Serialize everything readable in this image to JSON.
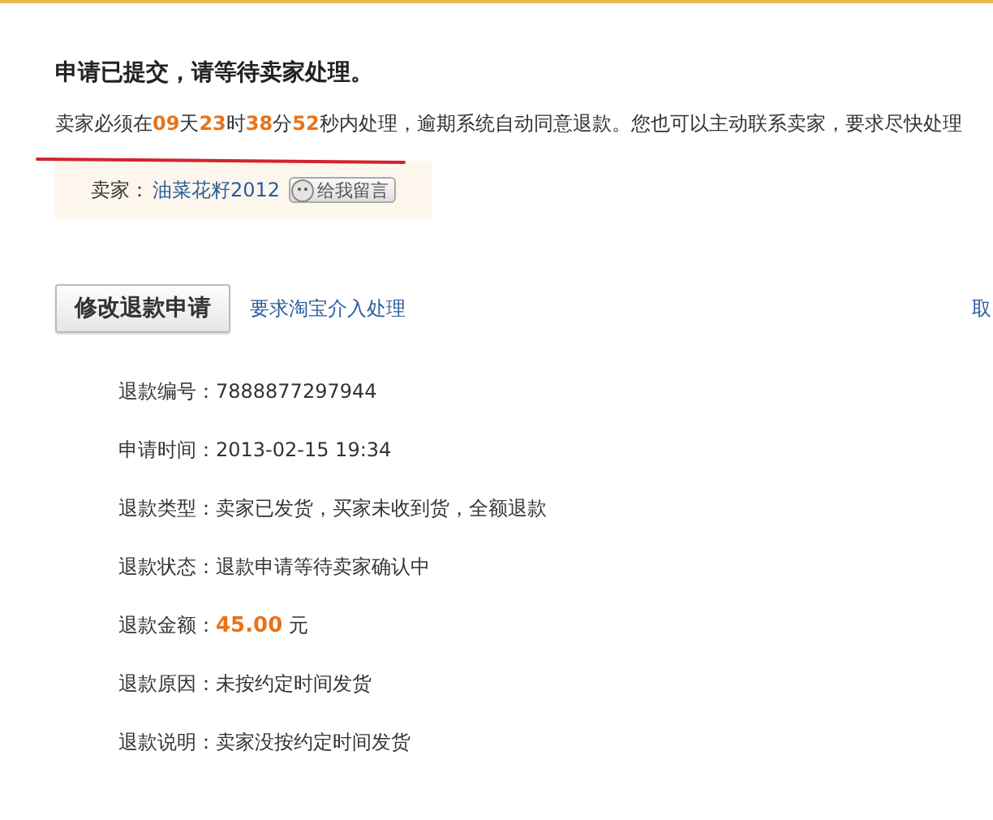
{
  "title": "申请已提交，请等待卖家处理。",
  "countdown": "卖家必须在**09**天**23**时**38**分**52**秒内处理，逾期系统自动同意退款。您也可以主动联系卖家，要求尽快处理",
  "seller": {
    "label": "卖家：",
    "name": "油菜花籽2012",
    "message_button": "给我留言"
  },
  "actions": {
    "primary": "修改退款申请",
    "link": "要求淘宝介入处理",
    "right_link": "取"
  },
  "details": [
    {
      "label": "退款编号：",
      "value": "7888877297944"
    },
    {
      "label": "申请时间：",
      "value": "2013-02-15 19:34"
    },
    {
      "label": "退款类型：",
      "value": "卖家已发货，买家未收到货，全额退款"
    },
    {
      "label": "退款状态：",
      "value": "退款申请等待卖家确认中"
    },
    {
      "label": "退款金额：",
      "value": "**45.00** 元"
    },
    {
      "label": "退款原因：",
      "value": "未按约定时间发货"
    },
    {
      "label": "退款说明：",
      "value": "卖家没按约定时间发货"
    }
  ]
}
